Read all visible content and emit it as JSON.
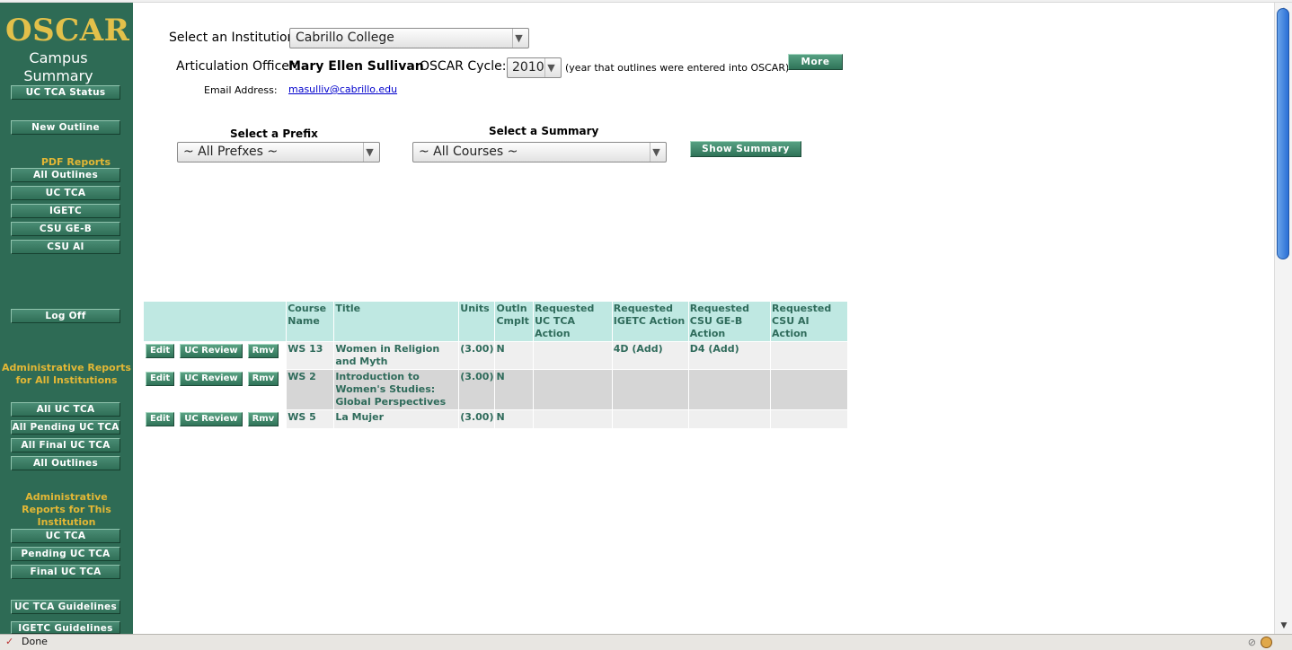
{
  "sidebar": {
    "logo": "OSCAR",
    "title_line1": "Campus",
    "title_line2": "Summary",
    "uc_tca_status": "UC TCA Status",
    "new_outline": "New Outline",
    "pdf_reports_heading": "PDF Reports",
    "pdf_items": [
      "All Outlines",
      "UC TCA",
      "IGETC",
      "CSU GE-B",
      "CSU AI"
    ],
    "log_off": "Log Off",
    "admin_all_heading_1": "Administrative Reports",
    "admin_all_heading_2": "for All Institutions",
    "admin_all_items": [
      "All UC TCA",
      "All Pending UC TCA",
      "All Final UC TCA",
      "All Outlines"
    ],
    "admin_this_heading_1": "Administrative",
    "admin_this_heading_2": "Reports for This",
    "admin_this_heading_3": "Institution",
    "admin_this_items": [
      "UC TCA",
      "Pending UC TCA",
      "Final UC TCA"
    ],
    "guidelines": [
      "UC TCA Guidelines",
      "IGETC Guidelines"
    ]
  },
  "header": {
    "institution_label": "Select an Institution:",
    "institution_value": "Cabrillo College",
    "officer_label": "Articulation Officer:",
    "officer_name": "Mary Ellen Sullivan",
    "cycle_label": "OSCAR Cycle:",
    "cycle_value": "2010",
    "cycle_note": "(year that outlines were entered into OSCAR)",
    "more_info": "More Info",
    "email_label": "Email Address:",
    "email_value": "masulliv@cabrillo.edu"
  },
  "filters": {
    "prefix_label": "Select a Prefix",
    "prefix_value": "~ All Prefxes ~",
    "summary_label": "Select a Summary",
    "summary_value": "~ All Courses ~",
    "show_summary": "Show Summary"
  },
  "table": {
    "headers": [
      "Course Name",
      "Title",
      "Units",
      "Outln Cmplt",
      "Requested UC TCA Action",
      "Requested IGETC Action",
      "Requested CSU GE-B Action",
      "Requested CSU AI Action"
    ],
    "row_buttons": [
      "Edit",
      "UC Review",
      "Rmv"
    ],
    "rows": [
      {
        "course": "WS 13",
        "title": "Women in Religion and Myth",
        "units": "(3.00)",
        "complete": "N",
        "uc_tca": "",
        "igetc": "4D (Add)",
        "csu_geb": "D4 (Add)",
        "csu_ai": ""
      },
      {
        "course": "WS 2",
        "title": "Introduction to Women's Studies: Global Perspectives",
        "units": "(3.00)",
        "complete": "N",
        "uc_tca": "",
        "igetc": "",
        "csu_geb": "",
        "csu_ai": ""
      },
      {
        "course": "WS 5",
        "title": "La Mujer",
        "units": "(3.00)",
        "complete": "N",
        "uc_tca": "",
        "igetc": "",
        "csu_geb": "",
        "csu_ai": ""
      }
    ]
  },
  "status": {
    "text": "Done"
  },
  "icons": {
    "dropdown": "chevron-down-icon",
    "scroll_up": "arrow-up-icon",
    "scroll_down": "arrow-down-icon"
  }
}
